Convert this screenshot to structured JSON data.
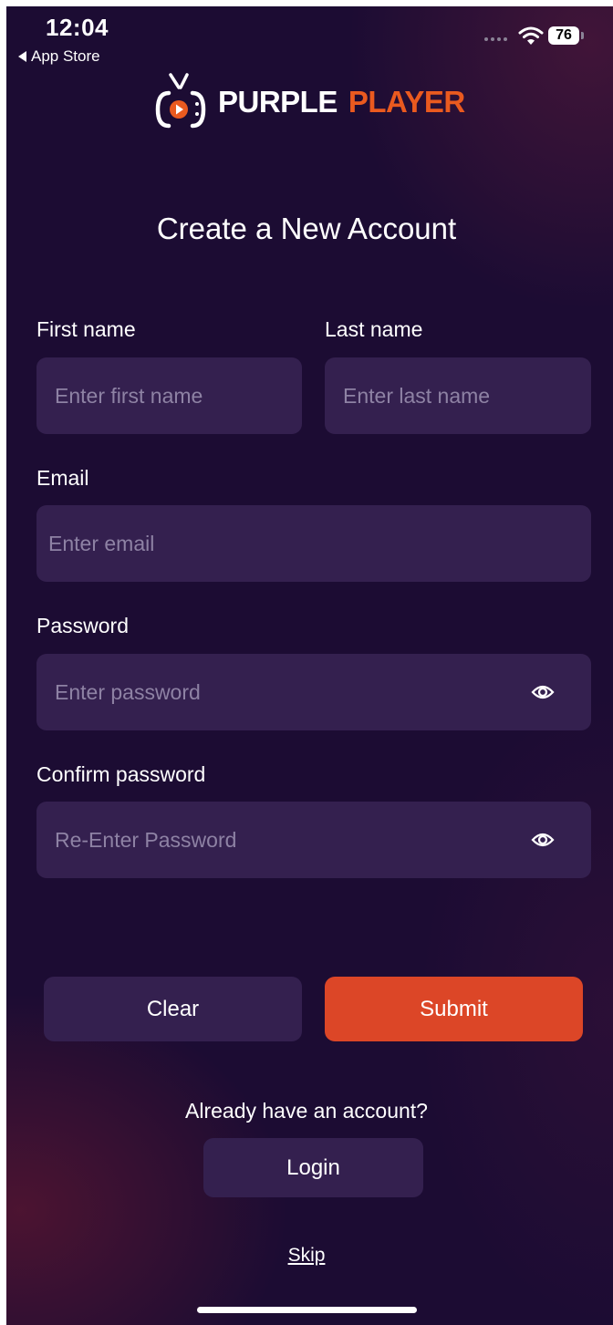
{
  "status_bar": {
    "time": "12:04",
    "back_label": "App Store",
    "battery": "76"
  },
  "logo": {
    "word1": "PURPLE",
    "word2": "PLAYER"
  },
  "page_title": "Create a New Account",
  "form": {
    "first_name": {
      "label": "First name",
      "placeholder": "Enter first name",
      "value": ""
    },
    "last_name": {
      "label": "Last name",
      "placeholder": "Enter last name",
      "value": ""
    },
    "email": {
      "label": "Email",
      "placeholder": "Enter email",
      "value": ""
    },
    "password": {
      "label": "Password",
      "placeholder": "Enter password",
      "value": ""
    },
    "confirm_password": {
      "label": "Confirm password",
      "placeholder": "Re-Enter Password",
      "value": ""
    }
  },
  "actions": {
    "clear_label": "Clear",
    "submit_label": "Submit"
  },
  "login": {
    "prompt": "Already have an account?",
    "button_label": "Login"
  },
  "skip_label": "Skip",
  "colors": {
    "background": "#1c0c33",
    "field": "#34204f",
    "accent": "#dc4627",
    "logo_accent": "#ea5a1f"
  }
}
